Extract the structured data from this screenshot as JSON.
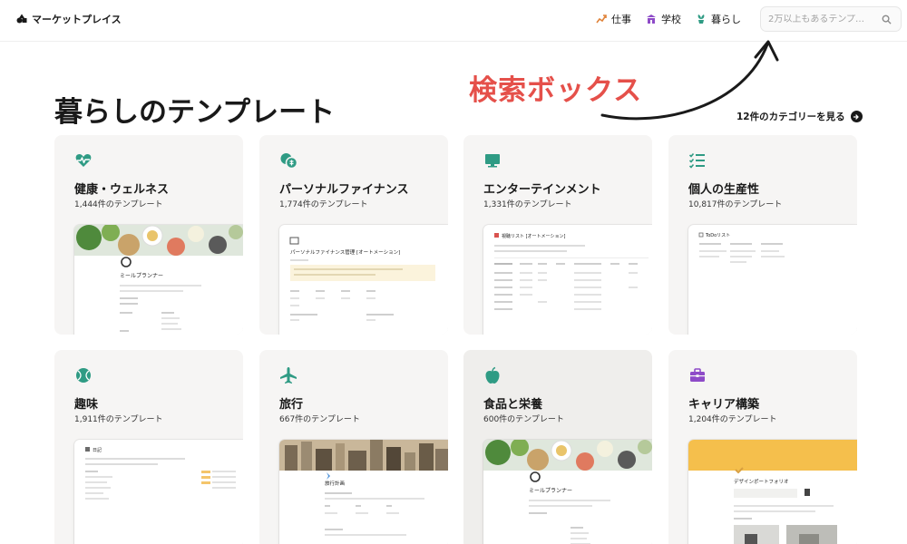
{
  "header": {
    "logo_label": "マーケットプレイス",
    "nav": [
      {
        "label": "仕事",
        "icon": "chart-icon",
        "color": "#e0833a"
      },
      {
        "label": "学校",
        "icon": "school-icon",
        "color": "#8e4bc8"
      },
      {
        "label": "暮らし",
        "icon": "plant-icon",
        "color": "#2f9b84"
      }
    ],
    "search": {
      "placeholder": "2万以上もあるテンプ…",
      "value": ""
    }
  },
  "annotation": {
    "text": "検索ボックス",
    "color": "#e5504a"
  },
  "page": {
    "title": "暮らしのテンプレート",
    "see_all": "12件のカテゴリーを見る"
  },
  "categories": [
    {
      "name": "健康・ウェルネス",
      "count": "1,444件のテンプレート",
      "icon": "heart-pulse-icon"
    },
    {
      "name": "パーソナルファイナンス",
      "count": "1,774件のテンプレート",
      "icon": "coins-icon"
    },
    {
      "name": "エンターテインメント",
      "count": "1,331件のテンプレート",
      "icon": "monitor-icon"
    },
    {
      "name": "個人の生産性",
      "count": "10,817件のテンプレート",
      "icon": "checklist-icon"
    },
    {
      "name": "趣味",
      "count": "1,911件のテンプレート",
      "icon": "ball-icon"
    },
    {
      "name": "旅行",
      "count": "667件のテンプレート",
      "icon": "airplane-icon"
    },
    {
      "name": "食品と栄養",
      "count": "600件のテンプレート",
      "icon": "apple-icon"
    },
    {
      "name": "キャリア構築",
      "count": "1,204件のテンプレート",
      "icon": "briefcase-icon"
    }
  ],
  "thumbnails": {
    "meal_planner": "ミールプランナー",
    "finance": "パーソナルファイナンス管理 [オートメーション]",
    "watchlist": "視聴リスト [オートメーション]",
    "todo": "ToDoリスト",
    "hobby": "日記",
    "travel": "旅行計画",
    "portfolio": "デザインポートフォリオ"
  },
  "colors": {
    "accent_green": "#2f9b84",
    "accent_purple": "#8e4bc8",
    "text": "#191919"
  }
}
